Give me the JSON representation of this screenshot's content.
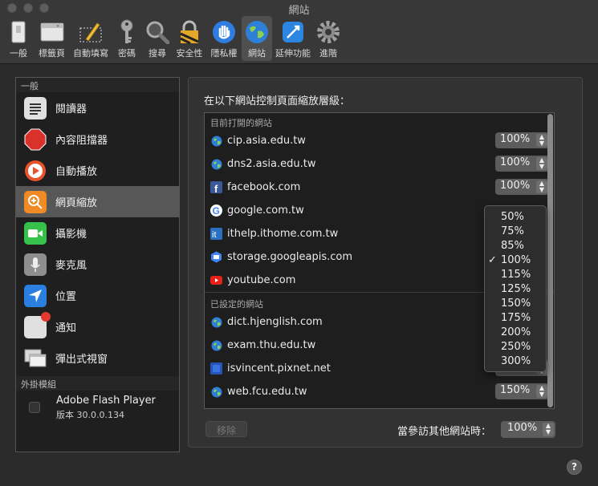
{
  "window": {
    "title": "網站"
  },
  "toolbar": {
    "tabs": [
      {
        "label": "一般",
        "icon": "switch-icon"
      },
      {
        "label": "標籤頁",
        "icon": "tabs-icon"
      },
      {
        "label": "自動填寫",
        "icon": "pencil-icon"
      },
      {
        "label": "密碼",
        "icon": "key-icon"
      },
      {
        "label": "搜尋",
        "icon": "magnifier-icon"
      },
      {
        "label": "安全性",
        "icon": "padlock-icon"
      },
      {
        "label": "隱私權",
        "icon": "hand-icon"
      },
      {
        "label": "網站",
        "icon": "globe-icon",
        "active": true
      },
      {
        "label": "延伸功能",
        "icon": "extension-icon"
      },
      {
        "label": "進階",
        "icon": "gear-icon"
      }
    ]
  },
  "sidebar": {
    "general_header": "一般",
    "items": [
      {
        "label": "閱讀器",
        "icon": "reader-icon",
        "color": "#d9d9d9"
      },
      {
        "label": "內容阻擋器",
        "icon": "stop-sign-icon",
        "color": "#d9322a"
      },
      {
        "label": "自動播放",
        "icon": "play-icon",
        "color": "#e8532b"
      },
      {
        "label": "網頁縮放",
        "icon": "zoom-icon",
        "color": "#f08a24",
        "selected": true
      },
      {
        "label": "攝影機",
        "icon": "camera-icon",
        "color": "#36c24a"
      },
      {
        "label": "麥克風",
        "icon": "microphone-icon",
        "color": "#8e8e8e"
      },
      {
        "label": "位置",
        "icon": "location-icon",
        "color": "#2a7fe0"
      },
      {
        "label": "通知",
        "icon": "notification-icon",
        "color": "#e0e0e0"
      },
      {
        "label": "彈出式視窗",
        "icon": "popup-window-icon",
        "color": "#d0d0d0"
      }
    ],
    "plugins_header": "外掛模組",
    "plugin": {
      "name": "Adobe Flash Player",
      "version": "版本 30.0.0.134"
    }
  },
  "main": {
    "heading": "在以下網站控制頁面縮放層級：",
    "open_header": "目前打開的網站",
    "open_sites": [
      {
        "domain": "cip.asia.edu.tw",
        "zoom": "100%",
        "icon": "globe-icon",
        "show_button": true
      },
      {
        "domain": "dns2.asia.edu.tw",
        "zoom": "100%",
        "icon": "globe-icon",
        "show_button": true
      },
      {
        "domain": "facebook.com",
        "zoom": "100%",
        "icon": "facebook-icon",
        "show_button": true
      },
      {
        "domain": "google.com.tw",
        "zoom": "",
        "icon": "google-icon",
        "show_button": false
      },
      {
        "domain": "ithelp.ithome.com.tw",
        "zoom": "",
        "icon": "ithelp-icon",
        "show_button": false
      },
      {
        "domain": "storage.googleapis.com",
        "zoom": "",
        "icon": "google-cloud-icon",
        "show_button": false
      },
      {
        "domain": "youtube.com",
        "zoom": "",
        "icon": "youtube-icon",
        "show_button": false
      }
    ],
    "configured_header": "已設定的網站",
    "configured_sites": [
      {
        "domain": "dict.hjenglish.com",
        "zoom": "",
        "icon": "globe-icon",
        "show_button": false
      },
      {
        "domain": "exam.thu.edu.tw",
        "zoom": "",
        "icon": "globe-icon",
        "show_button": false
      },
      {
        "domain": "isvincent.pixnet.net",
        "zoom": "85%",
        "icon": "pixnet-icon",
        "show_button": true
      },
      {
        "domain": "web.fcu.edu.tw",
        "zoom": "150%",
        "icon": "globe-icon",
        "show_button": true
      }
    ],
    "remove_label": "移除",
    "other_label": "當參訪其他網站時：",
    "other_value": "100%"
  },
  "zoom_menu": {
    "options": [
      "50%",
      "75%",
      "85%",
      "100%",
      "115%",
      "125%",
      "150%",
      "175%",
      "200%",
      "250%",
      "300%"
    ],
    "selected": "100%",
    "checkmark": "✓"
  },
  "help": {
    "label": "?"
  }
}
